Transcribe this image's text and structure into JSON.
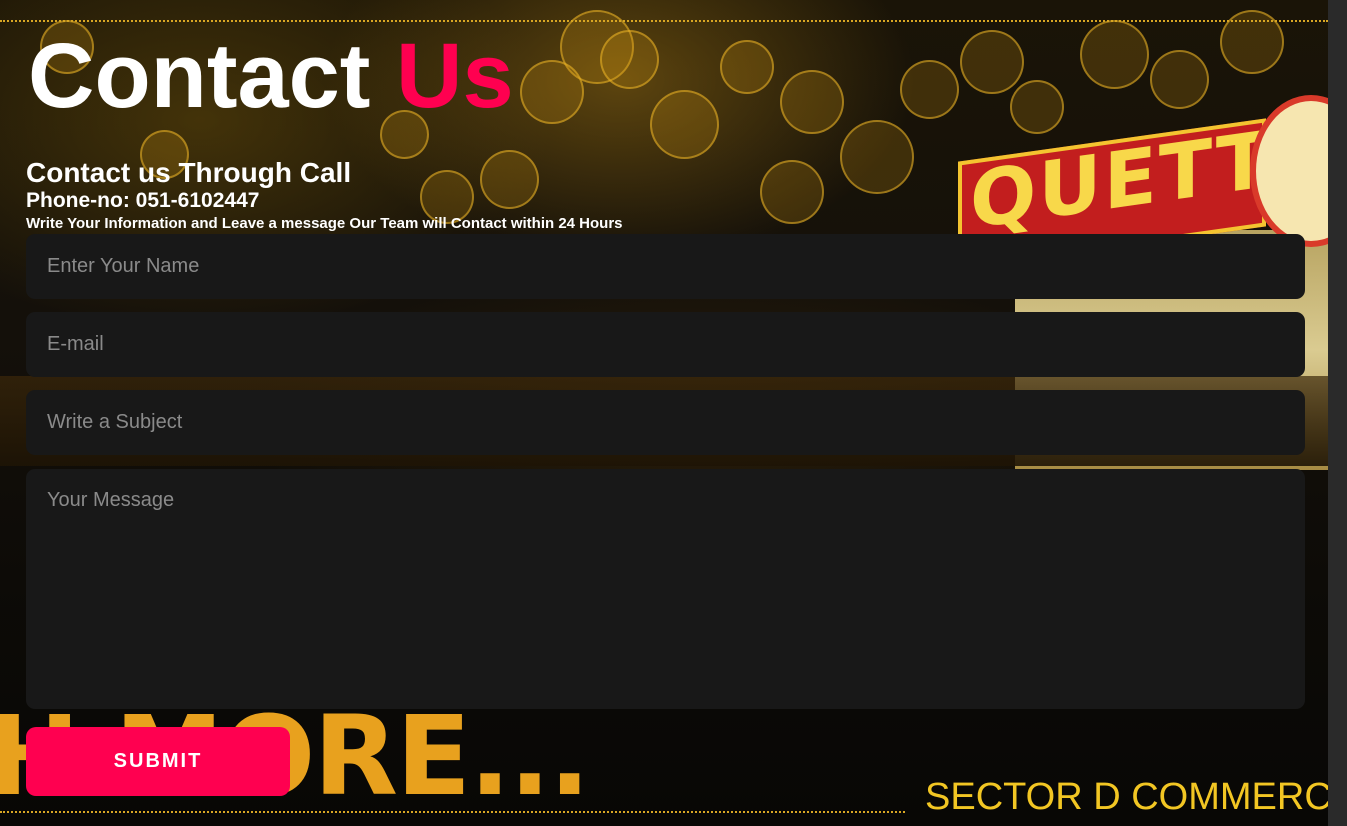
{
  "header": {
    "title_main": "Contact",
    "title_accent": "Us"
  },
  "info": {
    "call_heading": "Contact us Through Call",
    "phone": "Phone-no: 051-6102447",
    "note": "Write Your Information and Leave a message Our Team will Contact within 24 Hours"
  },
  "form": {
    "name_placeholder": "Enter Your Name",
    "email_placeholder": "E-mail",
    "subject_placeholder": "Write a Subject",
    "message_placeholder": "Your Message",
    "submit_label": "SUBMIT"
  },
  "background": {
    "sign_text": "QUETTA",
    "banner_text": "H MORE...",
    "sector_text": "SECTOR D COMMERCI"
  },
  "colors": {
    "accent": "#ff0050",
    "field_bg": "#181818",
    "gold": "#e8a11e"
  }
}
